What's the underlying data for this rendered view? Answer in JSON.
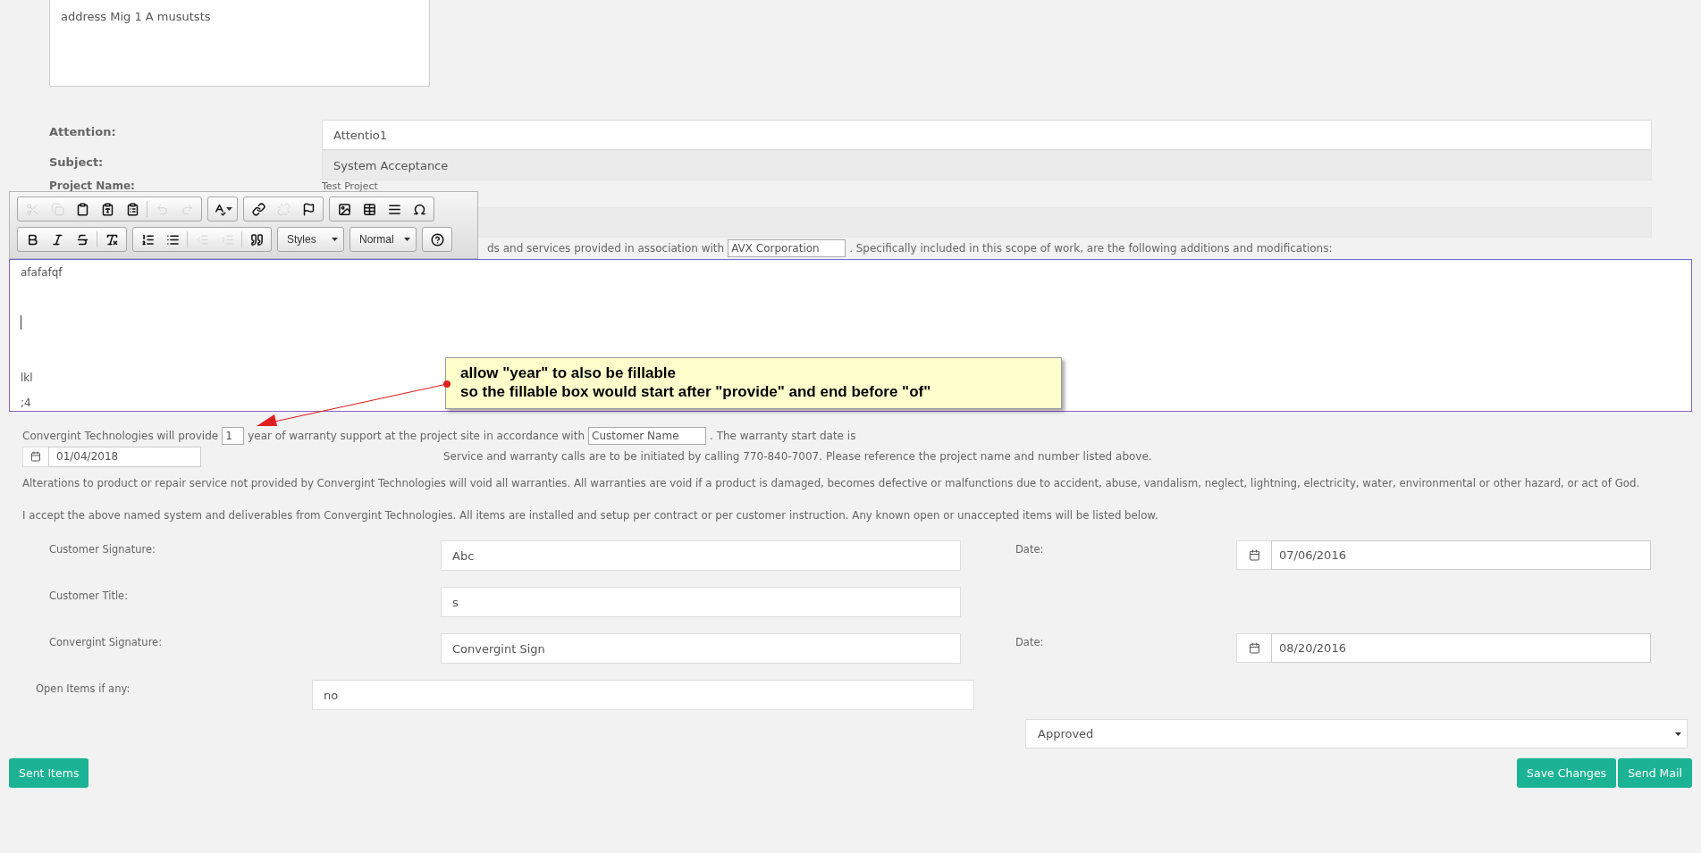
{
  "address": {
    "value": "address Mig 1 A musutsts"
  },
  "fields": [
    {
      "label": "Attention:",
      "value": "Attentio1",
      "disabled": false
    },
    {
      "label": "Subject:",
      "value": "System Acceptance",
      "disabled": true
    }
  ],
  "project": {
    "label": "Project Name:",
    "value": "Test Project"
  },
  "toolbar": {
    "rows": [
      {
        "groups": [
          {
            "kind": "buttons",
            "buttons": [
              {
                "kind": "cut",
                "disabled": true
              },
              {
                "kind": "copy",
                "disabled": true
              },
              {
                "kind": "paste",
                "disabled": false
              },
              {
                "kind": "paste-text",
                "disabled": false
              },
              {
                "kind": "paste-word",
                "disabled": false
              },
              {
                "kind": "separator"
              },
              {
                "kind": "undo",
                "disabled": true
              },
              {
                "kind": "redo",
                "disabled": true
              }
            ]
          },
          {
            "kind": "buttons",
            "buttons": [
              {
                "kind": "spellcheck",
                "disabled": false
              }
            ]
          },
          {
            "kind": "buttons",
            "buttons": [
              {
                "kind": "link",
                "disabled": false
              },
              {
                "kind": "unlink",
                "disabled": true
              },
              {
                "kind": "anchor",
                "disabled": false
              }
            ]
          },
          {
            "kind": "buttons",
            "buttons": [
              {
                "kind": "image",
                "disabled": false
              },
              {
                "kind": "table",
                "disabled": false
              },
              {
                "kind": "rule",
                "disabled": false
              },
              {
                "kind": "special-char",
                "disabled": false
              }
            ]
          }
        ]
      },
      {
        "groups": [
          {
            "kind": "buttons",
            "buttons": [
              {
                "kind": "bold",
                "disabled": false
              },
              {
                "kind": "italic",
                "disabled": false
              },
              {
                "kind": "strike",
                "disabled": false
              },
              {
                "kind": "separator"
              },
              {
                "kind": "remove-format",
                "disabled": false
              }
            ]
          },
          {
            "kind": "buttons",
            "buttons": [
              {
                "kind": "numbered-list",
                "disabled": false
              },
              {
                "kind": "bulleted-list",
                "disabled": false
              },
              {
                "kind": "separator"
              },
              {
                "kind": "outdent",
                "disabled": true
              },
              {
                "kind": "indent",
                "disabled": true
              },
              {
                "kind": "separator"
              },
              {
                "kind": "blockquote",
                "disabled": false
              }
            ]
          },
          {
            "kind": "combo",
            "label": "Styles"
          },
          {
            "kind": "combo",
            "label": "Normal"
          },
          {
            "kind": "buttons",
            "buttons": [
              {
                "kind": "help",
                "disabled": false
              }
            ]
          }
        ]
      }
    ]
  },
  "scope_line": {
    "before": "ds and services provided in association with",
    "input": "AVX Corporation",
    "after": ". Specifically included in this scope of work, are the following additions and modifications:"
  },
  "editor": {
    "lines": [
      {
        "kind": "text",
        "text": "afafafqf"
      },
      {
        "kind": "blank"
      },
      {
        "kind": "caret"
      },
      {
        "kind": "blank"
      },
      {
        "kind": "text",
        "text": "lkl"
      },
      {
        "kind": "text",
        "text": ";4"
      }
    ]
  },
  "callout": {
    "lines": [
      "allow \"year\" to also be fillable",
      "so the fillable box would start after \"provide\" and end before \"of\""
    ]
  },
  "warranty": {
    "parts": [
      {
        "kind": "text",
        "text": "Convergint Technologies will provide"
      },
      {
        "kind": "input",
        "value": "1"
      },
      {
        "kind": "text",
        "text": "year of warranty support at the project site in accordance with"
      },
      {
        "kind": "input",
        "value": "Customer Name"
      },
      {
        "kind": "text",
        "text": ". The warranty start date is"
      }
    ],
    "start_date": "01/04/2018",
    "service_note": "Service and warranty calls are to be initiated by calling 770-840-7007. Please reference the project name and number listed above."
  },
  "paragraphs": [
    "Alterations to product or repair service not provided by Convergint Technologies will void all warranties. All warranties are void if a product is damaged, becomes defective or malfunctions due to accident, abuse, vandalism, neglect, lightning, electricity, water, environmental or other hazard, or act of God.",
    "I accept the above named system and deliverables from Convergint Technologies. All items are installed and setup per contract or per customer instruction. Any known open or unaccepted items will be listed below."
  ],
  "signatures": [
    {
      "label": "Customer Signature:",
      "value": "Abc",
      "date_label": "Date:",
      "date": "07/06/2016"
    },
    {
      "label": "Customer Title:",
      "value": "s"
    },
    {
      "label": "Convergint Signature:",
      "value": "Convergint Sign",
      "date_label": "Date:",
      "date": "08/20/2016"
    }
  ],
  "open_items": {
    "label": "Open Items if any:",
    "value": "no"
  },
  "status": {
    "value": "Approved"
  },
  "buttons": {
    "left": [
      "Sent Items"
    ],
    "right": [
      "Save Changes",
      "Send Mail"
    ]
  }
}
